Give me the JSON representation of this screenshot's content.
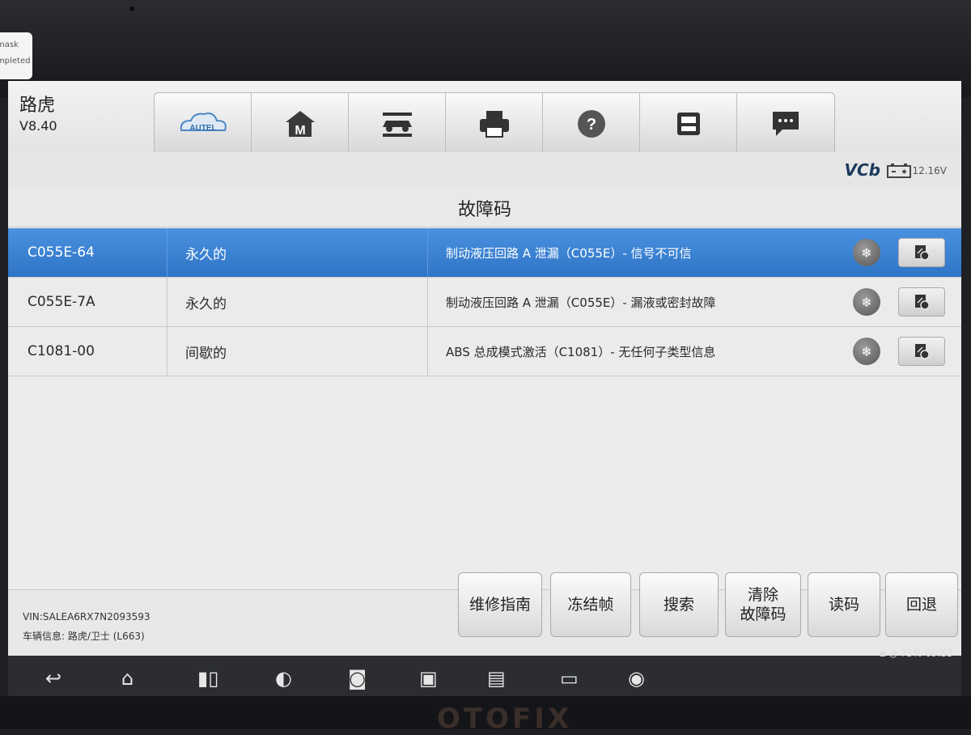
{
  "toast": {
    "line1": "mask",
    "line2": "mpleted"
  },
  "app": {
    "name": "路虎",
    "version": "V8.40"
  },
  "toolbar": {
    "buttons": [
      {
        "icon": "autel-logo-icon",
        "label": "AUTEL"
      },
      {
        "icon": "home-m-icon",
        "label": "M"
      },
      {
        "icon": "vehicle-lift-icon"
      },
      {
        "icon": "print-icon"
      },
      {
        "icon": "help-icon",
        "label": "?"
      },
      {
        "icon": "save-icon"
      },
      {
        "icon": "message-icon"
      }
    ]
  },
  "status": {
    "vci": "VCb",
    "voltage": "12.16V"
  },
  "page_title": "故障码",
  "dtc_rows": [
    {
      "code": "C055E-64",
      "status": "永久的",
      "description": "制动液压回路 A 泄漏（C055E）- 信号不可信",
      "selected": true
    },
    {
      "code": "C055E-7A",
      "status": "永久的",
      "description": "制动液压回路 A 泄漏（C055E）- 漏液或密封故障",
      "selected": false
    },
    {
      "code": "C1081-00",
      "status": "间歇的",
      "description": "ABS 总成模式激活（C1081）- 无任何子类型信息",
      "selected": false
    }
  ],
  "footer": {
    "vin": "VIN:SALEA6RX7N2093593",
    "vehicle_info": "车辆信息: 路虎/卫士 (L663)",
    "buttons": {
      "repair_guide": "维修指南",
      "freeze_frame": "冻结帧",
      "search": "搜索",
      "clear_line1": "清除",
      "clear_line2": "故障码",
      "read": "读码",
      "back": "回退"
    }
  },
  "system_status": {
    "battery": "75%",
    "time": "09:53"
  },
  "brand": "OTOFIX"
}
